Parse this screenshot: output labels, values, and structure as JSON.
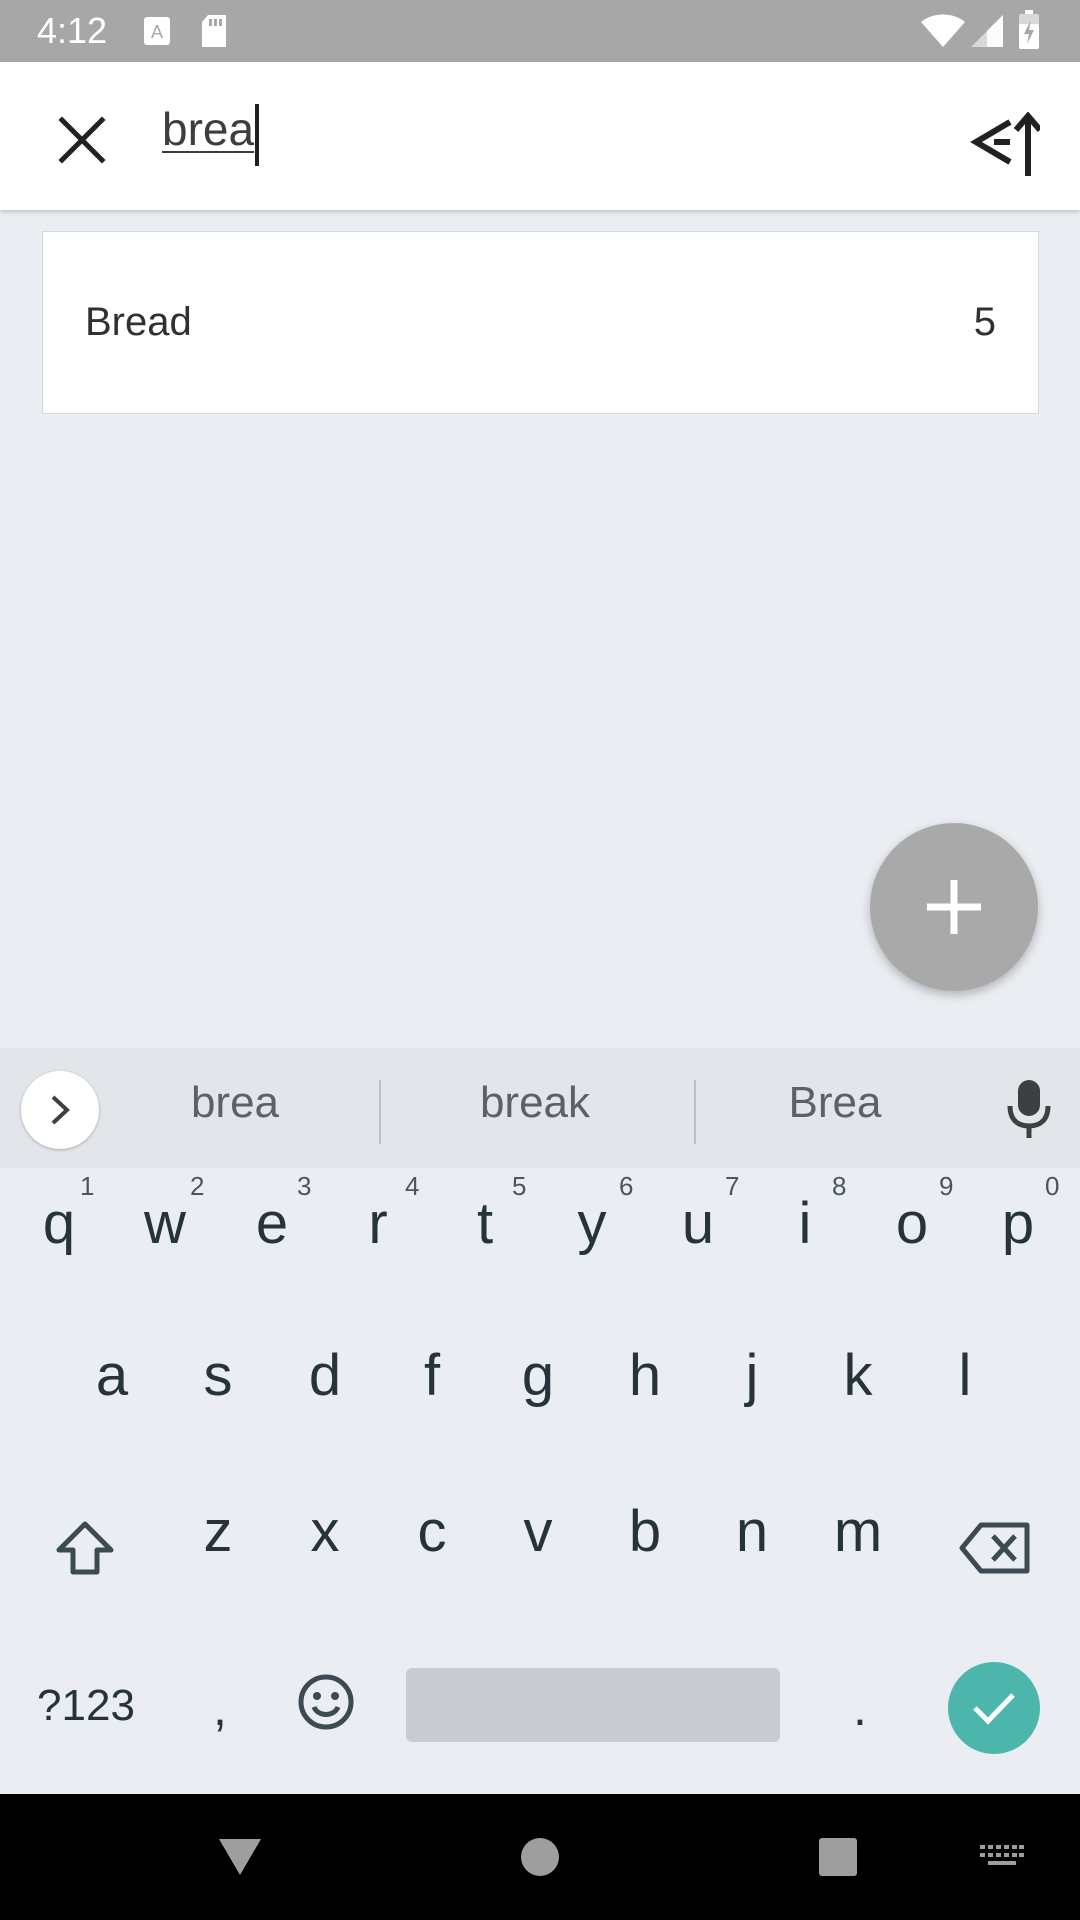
{
  "status_bar": {
    "time": "4:12",
    "icons": [
      "keyboard-a-icon",
      "sd-card-icon",
      "wifi-icon",
      "signal-icon",
      "battery-charging-icon"
    ]
  },
  "app_bar": {
    "search_value": "brea",
    "close_icon": "close-icon",
    "sort_icon": "sort-icon"
  },
  "results": [
    {
      "name": "Bread",
      "count": "5"
    }
  ],
  "fab": {
    "icon": "plus-icon"
  },
  "keyboard": {
    "suggestions": [
      "brea",
      "break",
      "Brea"
    ],
    "row1": [
      {
        "key": "q",
        "num": "1"
      },
      {
        "key": "w",
        "num": "2"
      },
      {
        "key": "e",
        "num": "3"
      },
      {
        "key": "r",
        "num": "4"
      },
      {
        "key": "t",
        "num": "5"
      },
      {
        "key": "y",
        "num": "6"
      },
      {
        "key": "u",
        "num": "7"
      },
      {
        "key": "i",
        "num": "8"
      },
      {
        "key": "o",
        "num": "9"
      },
      {
        "key": "p",
        "num": "0"
      }
    ],
    "row2": [
      "a",
      "s",
      "d",
      "f",
      "g",
      "h",
      "j",
      "k",
      "l"
    ],
    "row3": [
      "z",
      "x",
      "c",
      "v",
      "b",
      "n",
      "m"
    ],
    "symbols_label": "?123",
    "comma": ",",
    "period": ".",
    "enter_color": "#4db6ac"
  },
  "nav_bar": {
    "icons": [
      "back-icon",
      "home-icon",
      "recents-icon",
      "keyboard-switch-icon"
    ]
  }
}
